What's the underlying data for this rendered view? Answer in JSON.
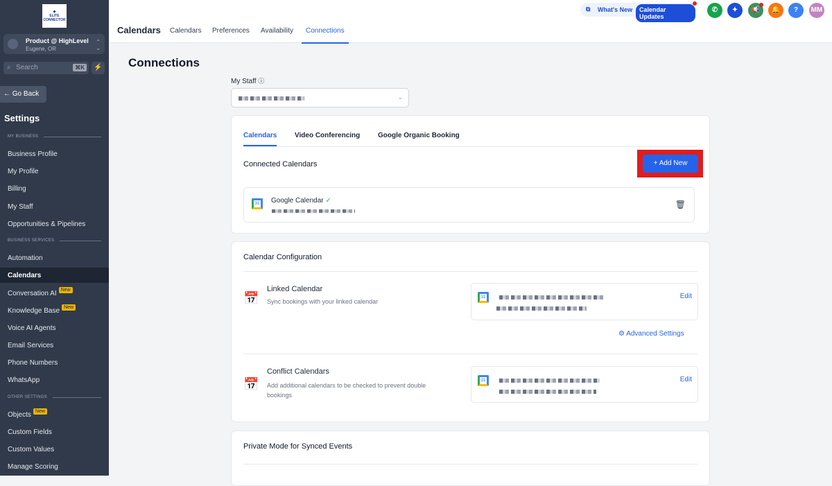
{
  "sidebar": {
    "logo_text": "ELITE CONNECTOR",
    "account_name": "Product @ HighLevel",
    "account_location": "Eugene, OR",
    "search_placeholder": "Search",
    "search_shortcut": "⌘K",
    "go_back": "Go Back",
    "title": "Settings",
    "sections": {
      "my_business": "MY BUSINESS",
      "business_services": "BUSINESS SERVICES",
      "other_settings": "OTHER SETTINGS"
    },
    "items": [
      {
        "label": "Business Profile"
      },
      {
        "label": "My Profile"
      },
      {
        "label": "Billing"
      },
      {
        "label": "My Staff"
      },
      {
        "label": "Opportunities & Pipelines"
      },
      {
        "label": "Automation"
      },
      {
        "label": "Calendars",
        "active": true
      },
      {
        "label": "Conversation AI",
        "badge": "New"
      },
      {
        "label": "Knowledge Base",
        "badge": "New"
      },
      {
        "label": "Voice AI Agents"
      },
      {
        "label": "Email Services"
      },
      {
        "label": "Phone Numbers"
      },
      {
        "label": "WhatsApp"
      },
      {
        "label": "Objects",
        "badge": "New"
      },
      {
        "label": "Custom Fields"
      },
      {
        "label": "Custom Values"
      },
      {
        "label": "Manage Scoring"
      }
    ]
  },
  "header": {
    "title": "Calendars",
    "tabs": [
      "Calendars",
      "Preferences",
      "Availability",
      "Connections"
    ],
    "whats_new": "What's New",
    "calendar_updates": "Calendar Updates",
    "avatar": "MM"
  },
  "page": {
    "title": "Connections",
    "staff_label": "My Staff",
    "card1": {
      "tabs": [
        "Calendars",
        "Video Conferencing",
        "Google Organic Booking"
      ],
      "heading": "Connected Calendars",
      "add_new": "+ Add New",
      "calendar_name": "Google Calendar"
    },
    "card2": {
      "heading": "Calendar Configuration",
      "linked_title": "Linked Calendar",
      "linked_desc": "Sync bookings with your linked calendar",
      "edit": "Edit",
      "advanced": "Advanced Settings",
      "conflict_title": "Conflict Calendars",
      "conflict_desc": "Add additional calendars to be checked to prevent double bookings"
    },
    "card3": {
      "heading": "Private Mode for Synced Events"
    }
  },
  "colors": {
    "accent": "#2563eb",
    "sidebar": "#303a4b",
    "highlight": "#e11d1d"
  }
}
